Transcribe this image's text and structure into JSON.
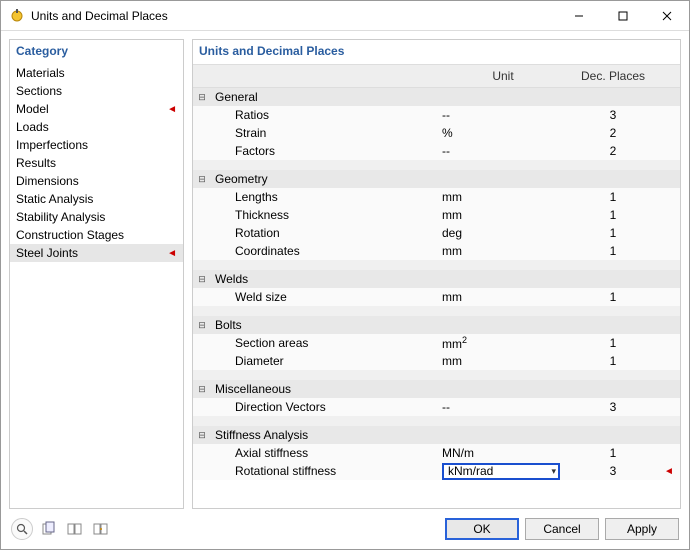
{
  "window": {
    "title": "Units and Decimal Places"
  },
  "left": {
    "header": "Category",
    "items": [
      {
        "label": "Materials",
        "marker": ""
      },
      {
        "label": "Sections",
        "marker": ""
      },
      {
        "label": "Model",
        "marker": "◄"
      },
      {
        "label": "Loads",
        "marker": ""
      },
      {
        "label": "Imperfections",
        "marker": ""
      },
      {
        "label": "Results",
        "marker": ""
      },
      {
        "label": "Dimensions",
        "marker": ""
      },
      {
        "label": "Static Analysis",
        "marker": ""
      },
      {
        "label": "Stability Analysis",
        "marker": ""
      },
      {
        "label": "Construction Stages",
        "marker": ""
      },
      {
        "label": "Steel Joints",
        "marker": "◄",
        "selected": true
      }
    ]
  },
  "right": {
    "header": "Units and Decimal Places",
    "columns": {
      "unit": "Unit",
      "dec": "Dec. Places"
    },
    "groups": [
      {
        "name": "General",
        "rows": [
          {
            "name": "Ratios",
            "unit": "--",
            "dec": "3"
          },
          {
            "name": "Strain",
            "unit": "%",
            "dec": "2"
          },
          {
            "name": "Factors",
            "unit": "--",
            "dec": "2"
          }
        ]
      },
      {
        "name": "Geometry",
        "rows": [
          {
            "name": "Lengths",
            "unit": "mm",
            "dec": "1"
          },
          {
            "name": "Thickness",
            "unit": "mm",
            "dec": "1"
          },
          {
            "name": "Rotation",
            "unit": "deg",
            "dec": "1"
          },
          {
            "name": "Coordinates",
            "unit": "mm",
            "dec": "1"
          }
        ]
      },
      {
        "name": "Welds",
        "rows": [
          {
            "name": "Weld size",
            "unit": "mm",
            "dec": "1"
          }
        ]
      },
      {
        "name": "Bolts",
        "rows": [
          {
            "name": "Section areas",
            "unit": "mm²",
            "dec": "1"
          },
          {
            "name": "Diameter",
            "unit": "mm",
            "dec": "1"
          }
        ]
      },
      {
        "name": "Miscellaneous",
        "rows": [
          {
            "name": "Direction Vectors",
            "unit": "--",
            "dec": "3"
          }
        ]
      },
      {
        "name": "Stiffness Analysis",
        "rows": [
          {
            "name": "Axial stiffness",
            "unit": "MN/m",
            "dec": "1"
          },
          {
            "name": "Rotational stiffness",
            "unit": "kNm/rad",
            "dec": "3",
            "flag": "◄",
            "combo": true
          }
        ]
      }
    ]
  },
  "buttons": {
    "ok": "OK",
    "cancel": "Cancel",
    "apply": "Apply"
  }
}
